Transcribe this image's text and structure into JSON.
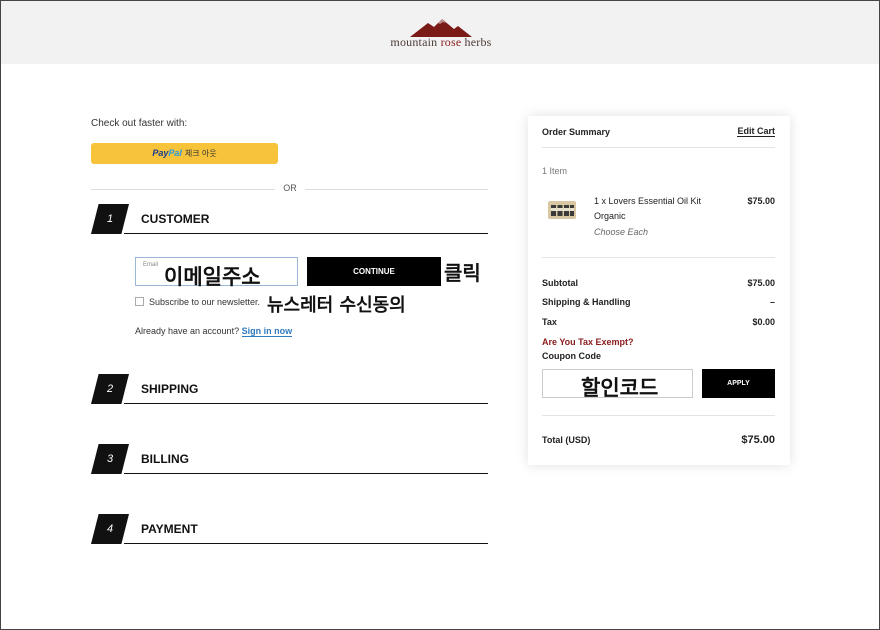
{
  "header": {
    "logo_prefix": "mountain ",
    "logo_rose": "rose",
    "logo_suffix": " herbs"
  },
  "express": {
    "label": "Check out faster with:",
    "paypal_pay": "Pay",
    "paypal_pal": "Pal",
    "paypal_label": "체크 아웃",
    "divider_text": "OR"
  },
  "sections": [
    {
      "step": "1",
      "title": "CUSTOMER"
    },
    {
      "step": "2",
      "title": "SHIPPING"
    },
    {
      "step": "3",
      "title": "BILLING"
    },
    {
      "step": "4",
      "title": "PAYMENT"
    }
  ],
  "customer": {
    "email_placeholder": "Email",
    "email_value": "이메일주소",
    "continue_label": "CONTINUE",
    "click_annotation": "클릭",
    "newsletter_label": "Subscribe to our newsletter.",
    "newsletter_annotation": "뉴스레터 수신동의",
    "newsletter_checked": false,
    "account_text": "Already have an account?",
    "sign_in_link": "Sign in now"
  },
  "summary": {
    "title": "Order Summary",
    "edit_cart": "Edit Cart",
    "item_count": "1 Item",
    "items": [
      {
        "name": "1 x Lovers Essential Oil Kit Organic",
        "option": "Choose Each",
        "price": "$75.00",
        "icon": "oil-kit-thumbnail"
      }
    ],
    "subtotal_label": "Subtotal",
    "subtotal_value": "$75.00",
    "shipping_label": "Shipping & Handling",
    "shipping_value": "–",
    "tax_label": "Tax",
    "tax_value": "$0.00",
    "tax_exempt_link": "Are You Tax Exempt?",
    "coupon_label": "Coupon Code",
    "coupon_value": "할인코드",
    "apply_label": "APPLY",
    "total_label": "Total (USD)",
    "total_value": "$75.00"
  },
  "colors": {
    "header_bg": "#f2f2f2",
    "paypal_yellow": "#f6c33b",
    "brand_maroon": "#8a1c1c",
    "link_blue": "#2f7bbd",
    "button_black": "#000000"
  }
}
